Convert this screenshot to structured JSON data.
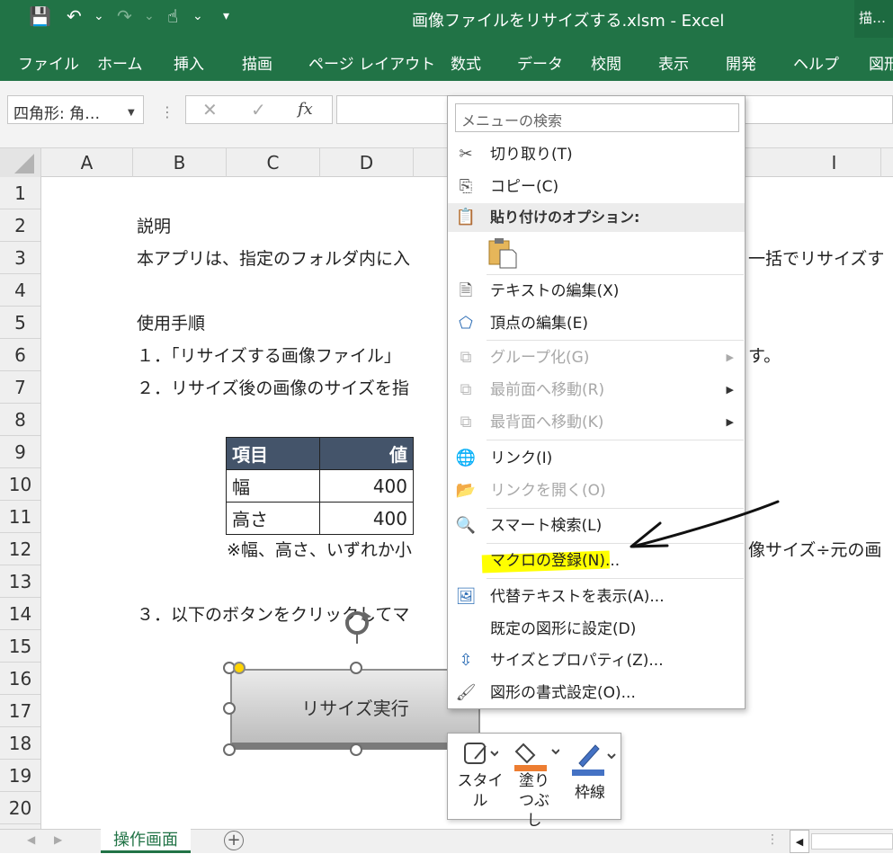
{
  "titlebar": {
    "title": "画像ファイルをリサイズする.xlsm  -  Excel",
    "context_tab": "描…",
    "qat": {
      "save": "💾",
      "undo": "↶",
      "undo_dd": "⌄",
      "redo": "↷",
      "redo_dd": "⌄",
      "touch": "☝",
      "touch_dd": "⌄",
      "customize": "▾"
    }
  },
  "ribbon": {
    "tabs": [
      "ファイル",
      "ホーム",
      "挿入",
      "描画",
      "ページ レイアウト",
      "数式",
      "データ",
      "校閲",
      "表示",
      "開発",
      "ヘルプ",
      "図形"
    ]
  },
  "formula_bar": {
    "name_box": "四角形: 角…",
    "cancel": "✕",
    "enter": "✓",
    "fx": "fx"
  },
  "columns": [
    "A",
    "B",
    "C",
    "D",
    "I"
  ],
  "rows": [
    "1",
    "2",
    "3",
    "4",
    "5",
    "6",
    "7",
    "8",
    "9",
    "10",
    "11",
    "12",
    "13",
    "14",
    "15",
    "16",
    "17",
    "18",
    "19",
    "20"
  ],
  "cells": {
    "r2": "説明",
    "r3_left": "本アプリは、指定のフォルダ内に入",
    "r3_right": "一括でリサイズす",
    "r5": "使用手順",
    "r6_left": "１．「リサイズする画像ファイル」",
    "r6_right": "す。",
    "r7": "２．リサイズ後の画像のサイズを指",
    "r12_left": "※幅、高さ、いずれか小",
    "r12_right": "像サイズ÷元の画",
    "r14": "３．以下のボタンをクリックしてマ"
  },
  "size_table": {
    "headers": [
      "項目",
      "値"
    ],
    "rows": [
      [
        "幅",
        "400"
      ],
      [
        "高さ",
        "400"
      ]
    ]
  },
  "shape_button": {
    "label": "リサイズ実行"
  },
  "sheet_tabs": {
    "active": "操作画面",
    "add": "+"
  },
  "context_menu": {
    "search_placeholder": "メニューの検索",
    "items": {
      "cut": "切り取り(T)",
      "copy": "コピー(C)",
      "paste_options": "貼り付けのオプション:",
      "edit_text": "テキストの編集(X)",
      "edit_points": "頂点の編集(E)",
      "group": "グループ化(G)",
      "bring_front": "最前面へ移動(R)",
      "send_back": "最背面へ移動(K)",
      "link": "リンク(I)",
      "open_link": "リンクを開く(O)",
      "smart_lookup": "スマート検索(L)",
      "assign_macro": "マクロの登録(N)...",
      "alt_text": "代替テキストを表示(A)...",
      "default_shape": "既定の図形に設定(D)",
      "size_props": "サイズとプロパティ(Z)...",
      "format_shape": "図形の書式設定(O)..."
    }
  },
  "mini_toolbar": {
    "style": "スタイル",
    "fill": "塗りつぶし",
    "outline": "枠線"
  },
  "colors": {
    "excel_green": "#217346",
    "table_header": "#44546a",
    "highlight": "#ffff00",
    "fill_orange": "#ed7d31",
    "outline_blue": "#4472c4"
  }
}
